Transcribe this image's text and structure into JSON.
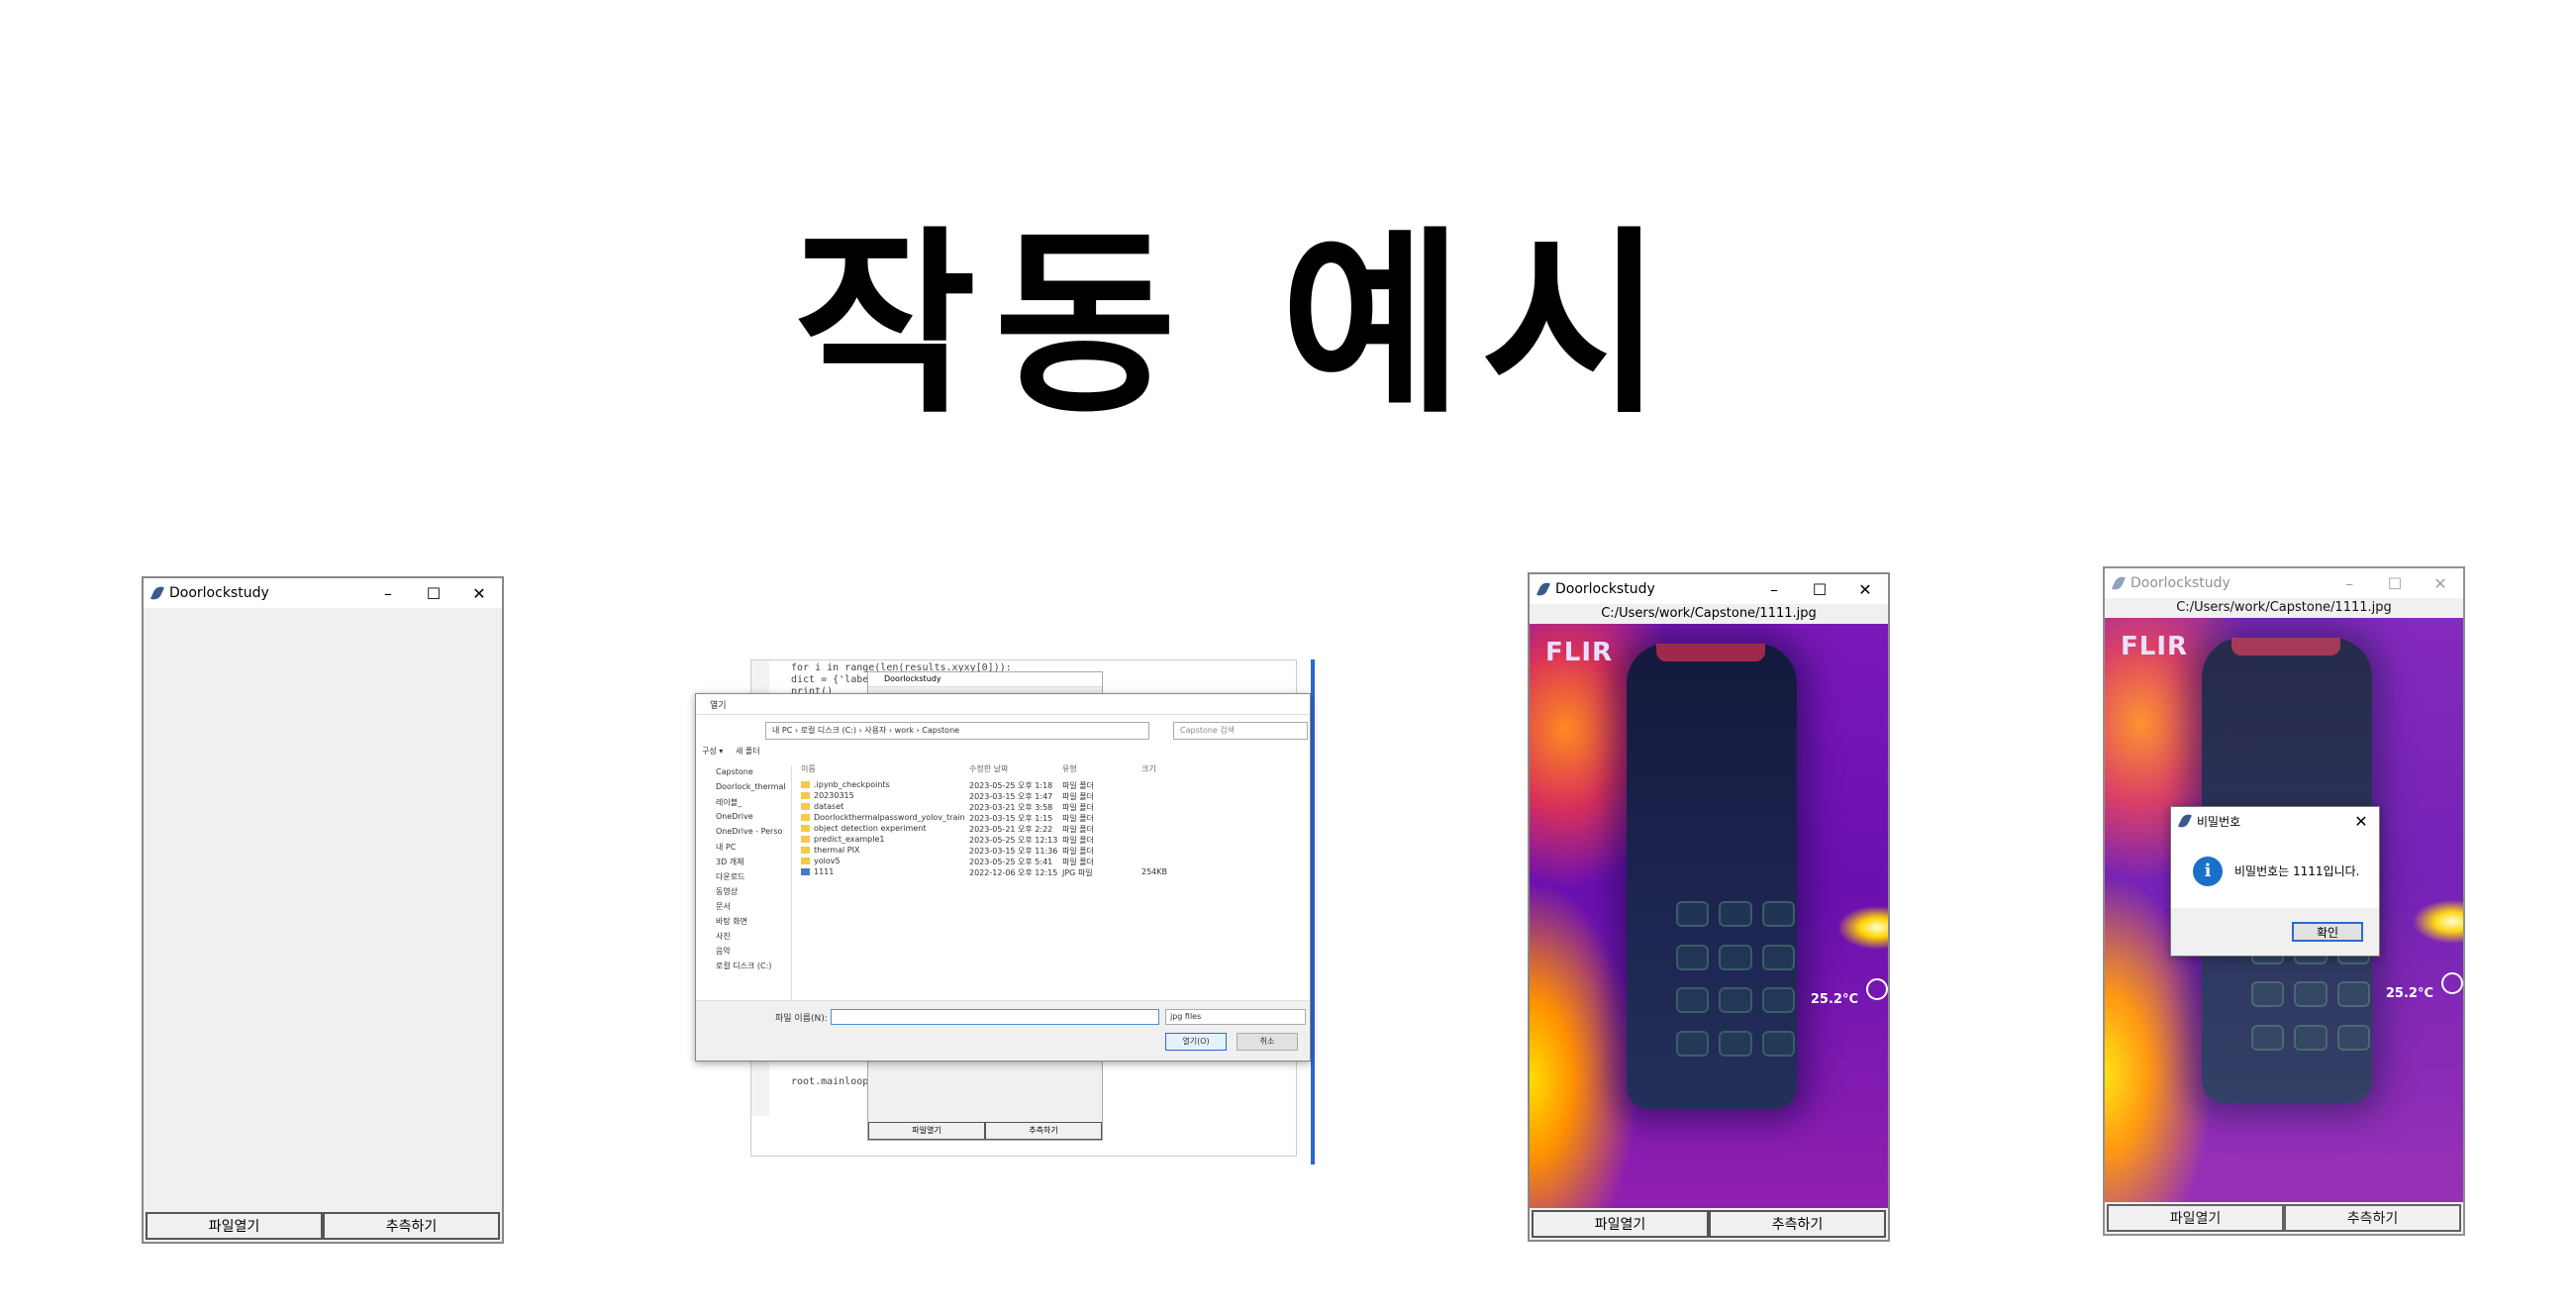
{
  "slide": {
    "title": "작동 예시"
  },
  "app": {
    "window_title": "Doorlockstudy",
    "open_button": "파일열기",
    "extract_button": "추측하기",
    "image_path": "C:/Users/work/Capstone/1111.jpg"
  },
  "window_controls": {
    "minimize": "–",
    "maximize": "☐",
    "close": "✕"
  },
  "thermal": {
    "brand": "FLIR",
    "temperature": "25.2°C"
  },
  "file_dialog": {
    "title": "열기",
    "address": "내 PC › 로컬 디스크 (C:) › 사용자 › work › Capstone",
    "search_placeholder": "Capstone 검색",
    "toolbar_organize": "구성 ▾",
    "toolbar_new_folder": "새 폴더",
    "sidebar": [
      "Capstone",
      "Doorlock_thermal",
      "레이블_",
      "OneDrive",
      "OneDrive - Perso",
      "내 PC",
      "3D 개체",
      "다운로드",
      "동영상",
      "문서",
      "바탕 화면",
      "사진",
      "음악",
      "로컬 디스크 (C:)"
    ],
    "columns": [
      "이름",
      "수정한 날짜",
      "유형",
      "크기"
    ],
    "files": [
      {
        "name": ".ipynb_checkpoints",
        "date": "2023-05-25 오후 1:18",
        "type": "파일 폴더",
        "size": ""
      },
      {
        "name": "20230315",
        "date": "2023-03-15 오후 1:47",
        "type": "파일 폴더",
        "size": ""
      },
      {
        "name": "dataset",
        "date": "2023-03-21 오후 3:58",
        "type": "파일 폴더",
        "size": ""
      },
      {
        "name": "Doorlockthermalpassword_yolov_train",
        "date": "2023-03-15 오후 1:15",
        "type": "파일 폴더",
        "size": ""
      },
      {
        "name": "object detection experiment",
        "date": "2023-05-21 오후 2:22",
        "type": "파일 폴더",
        "size": ""
      },
      {
        "name": "predict_example1",
        "date": "2023-05-25 오후 12:13",
        "type": "파일 폴더",
        "size": ""
      },
      {
        "name": "thermal PIX",
        "date": "2023-03-15 오후 11:36",
        "type": "파일 폴더",
        "size": ""
      },
      {
        "name": "yolov5",
        "date": "2023-05-25 오후 5:41",
        "type": "파일 폴더",
        "size": ""
      },
      {
        "name": "1111",
        "date": "2022-12-06 오후 12:15",
        "type": "JPG 파일",
        "size": "254KB"
      }
    ],
    "filename_label": "파일 이름(N):",
    "filetype": "jpg files",
    "open_label": "열기(O)",
    "cancel_label": "취소",
    "code_lines": [
      "for i in range(len(results.xyxy[0])):",
      "    dict = {'label': ...",
      "print()",
      "root.mainloop()"
    ]
  },
  "message_box": {
    "title": "비밀번호",
    "text": "비밀번호는 1111입니다.",
    "ok": "확인"
  }
}
